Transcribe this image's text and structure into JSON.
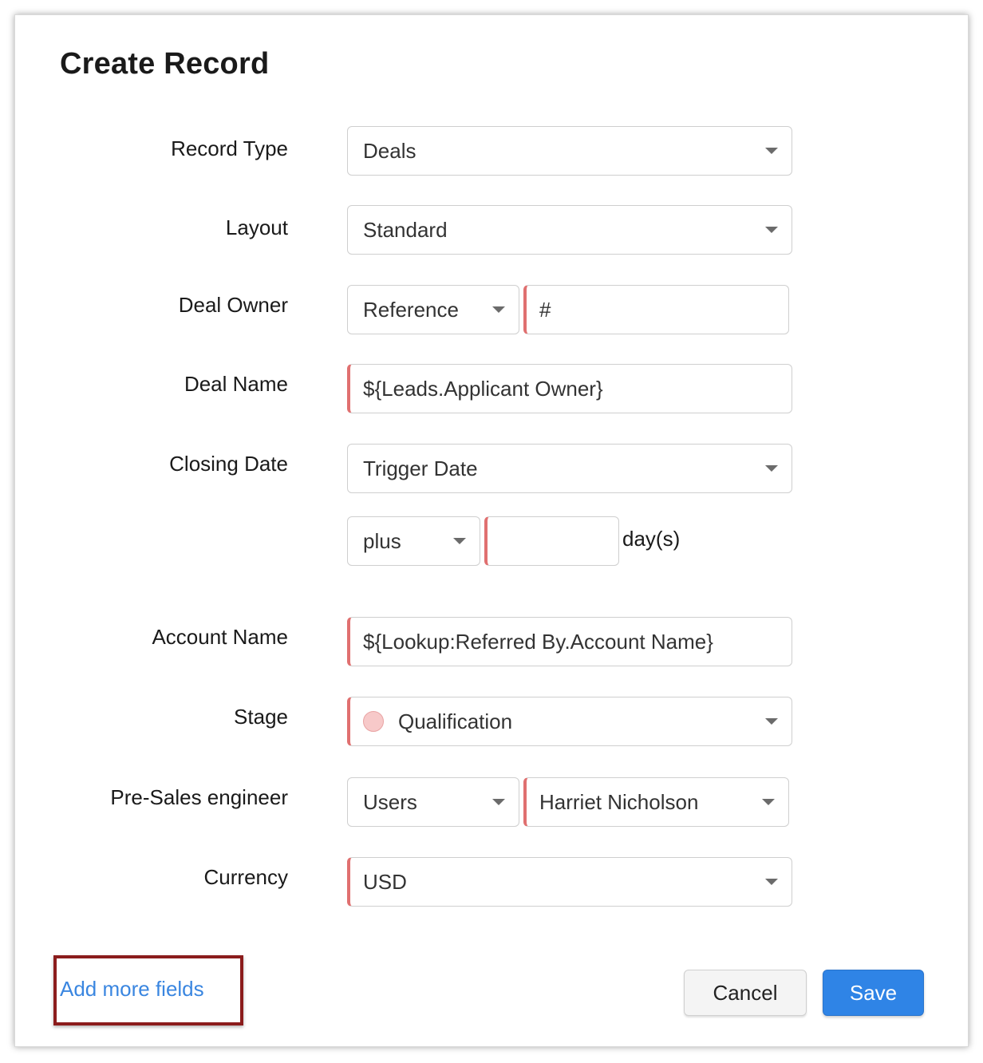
{
  "dialog": {
    "title": "Create Record",
    "fields": {
      "record_type": {
        "label": "Record Type",
        "value": "Deals"
      },
      "layout": {
        "label": "Layout",
        "value": "Standard"
      },
      "deal_owner": {
        "label": "Deal Owner",
        "type_value": "Reference",
        "value": "#"
      },
      "deal_name": {
        "label": "Deal Name",
        "value": "${Leads.Applicant Owner}"
      },
      "closing_date": {
        "label": "Closing Date",
        "value": "Trigger Date",
        "offset_op": "plus",
        "offset_value": "",
        "offset_unit": "day(s)"
      },
      "account_name": {
        "label": "Account Name",
        "value": "${Lookup:Referred By.Account Name}"
      },
      "stage": {
        "label": "Stage",
        "value": "Qualification",
        "dot_color": "#f7c9c9"
      },
      "pre_sales": {
        "label": "Pre-Sales engineer",
        "type_value": "Users",
        "value": "Harriet Nicholson"
      },
      "currency": {
        "label": "Currency",
        "value": "USD"
      }
    },
    "add_more_fields": "Add more fields",
    "cancel_label": "Cancel",
    "save_label": "Save"
  },
  "colors": {
    "accent": "#2f84e6",
    "link": "#3a86e0",
    "required_marker": "#e07070",
    "highlight_box": "#8b1c1c"
  }
}
